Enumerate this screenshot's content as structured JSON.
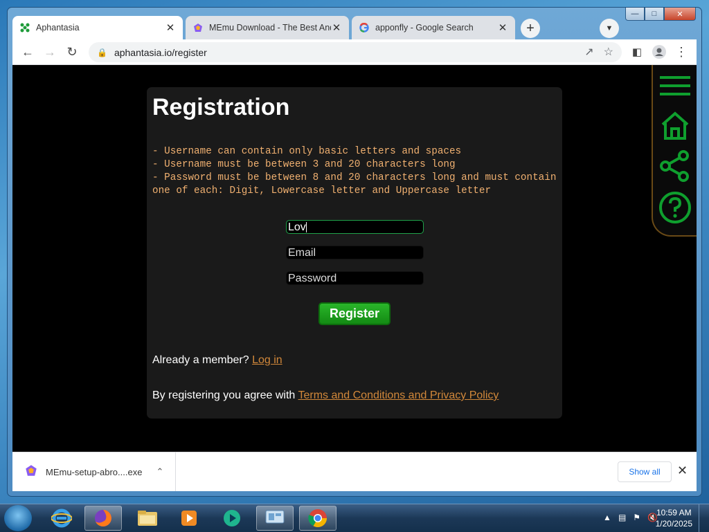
{
  "browser": {
    "tabs": [
      {
        "title": "Aphantasia",
        "active": true
      },
      {
        "title": "MEmu Download - The Best Andr",
        "active": false
      },
      {
        "title": "apponfly - Google Search",
        "active": false
      }
    ],
    "url": "aphantasia.io/register"
  },
  "page": {
    "heading": "Registration",
    "rules": [
      "- Username can contain only basic letters and spaces",
      "- Username must be between 3 and 20 characters long",
      "- Password must be between 8 and 20 characters long and must contain one of each: Digit, Lowercase letter and Uppercase letter"
    ],
    "username_value": "Lov",
    "email_placeholder": "Email",
    "password_placeholder": "Password",
    "register_label": "Register",
    "member_text": "Already a member?",
    "login_link": "Log in",
    "agree_text": "By registering you agree with",
    "terms_link": "Terms and Conditions and Privacy Policy",
    "accent_color": "#d2883a",
    "rules_color": "#f0b070"
  },
  "downloads": {
    "file": "MEmu-setup-abro....exe",
    "show_all": "Show all"
  },
  "taskbar": {
    "time": "10:59 AM",
    "date": "1/20/2025"
  }
}
